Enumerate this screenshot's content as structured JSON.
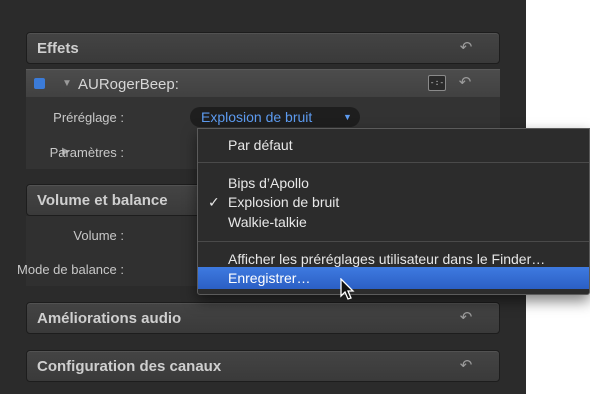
{
  "effects": {
    "title": "Effets",
    "plugin": {
      "name": "AURogerBeep:",
      "button_glyph": "-:-",
      "preset_label": "Préréglage :",
      "preset_value": "Explosion de bruit",
      "params_label": "Paramètres :"
    }
  },
  "volume": {
    "title": "Volume et balance",
    "volume_label": "Volume :",
    "balance_label": "Mode de balance :"
  },
  "audio_improvements": {
    "title": "Améliorations audio"
  },
  "channels": {
    "title": "Configuration des canaux"
  },
  "menu": {
    "items": [
      "Par défaut",
      "Bips d’Apollo",
      "Explosion de bruit",
      "Walkie-talkie",
      "Afficher les préréglages utilisateur dans le Finder…",
      "Enregistrer…"
    ],
    "checked": "Explosion de bruit",
    "highlighted": "Enregistrer…"
  },
  "icons": {
    "reset": "reset-arrow-icon",
    "disclosure": "disclosure-triangle-icon",
    "cursor": "pointer-cursor-icon"
  },
  "colors": {
    "accent": "#3b7bd8",
    "popup_text": "#5d9bf0",
    "menu_highlight": "#2f65cf",
    "panel": "#2b2b2b"
  }
}
